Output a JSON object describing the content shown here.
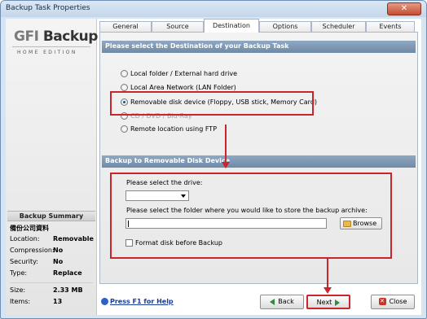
{
  "window": {
    "title": "Backup Task Properties",
    "close_glyph": "✕"
  },
  "logo": {
    "brand_gfi": "GFI",
    "brand_backup": "Backup",
    "edition": "HOME EDITION"
  },
  "tabs": [
    {
      "label": "General"
    },
    {
      "label": "Source"
    },
    {
      "label": "Destination"
    },
    {
      "label": "Options"
    },
    {
      "label": "Scheduler"
    },
    {
      "label": "Events"
    }
  ],
  "destination": {
    "header": "Please select the Destination of your Backup Task",
    "options": [
      {
        "label": "Local folder / External hard drive",
        "selected": false,
        "enabled": true
      },
      {
        "label": "Local Area Network (LAN Folder)",
        "selected": false,
        "enabled": true
      },
      {
        "label": "Removable disk device (Floppy, USB stick, Memory Card)",
        "selected": true,
        "enabled": true
      },
      {
        "label": "CD / DVD / Blu-Ray",
        "selected": false,
        "enabled": false
      },
      {
        "label": "Remote location using FTP",
        "selected": false,
        "enabled": true
      }
    ]
  },
  "removable": {
    "header": "Backup to Removable Disk Device",
    "drive_label": "Please select the drive:",
    "drive_value": "",
    "folder_label": "Please select the folder where you would like to store the backup archive:",
    "folder_value": "",
    "browse_label": "Browse",
    "format_label": "Format disk before Backup",
    "format_checked": false
  },
  "summary": {
    "header": "Backup Summary",
    "name": "備份公司資料",
    "rows": [
      {
        "key": "Location:",
        "value": "Removable"
      },
      {
        "key": "Compression:",
        "value": "No"
      },
      {
        "key": "Security:",
        "value": "No"
      },
      {
        "key": "Type:",
        "value": "Replace"
      }
    ],
    "stats": [
      {
        "key": "Size:",
        "value": "2.33 MB"
      },
      {
        "key": "Items:",
        "value": "13"
      }
    ]
  },
  "footer": {
    "help_label": "Press F1 for Help",
    "back_label": "Back",
    "next_label": "Next",
    "close_label": "Close"
  },
  "colors": {
    "highlight": "#c8262b",
    "section_bar": "#7c95b1",
    "help_link": "#1a3d99"
  }
}
